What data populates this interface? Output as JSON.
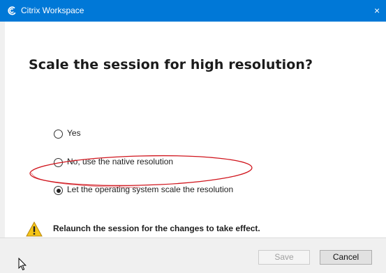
{
  "window": {
    "title": "Citrix Workspace",
    "close_glyph": "×",
    "accent_color": "#0078d7"
  },
  "dialog": {
    "heading": "Scale the session for high resolution?",
    "options": [
      {
        "label": "Yes",
        "selected": false
      },
      {
        "label": "No, use the native resolution",
        "selected": false
      },
      {
        "label": "Let the operating system scale the resolution",
        "selected": true
      }
    ],
    "warning_text": "Relaunch the session for the changes to take effect.",
    "warning_icon": "warning-triangle-icon",
    "highlight_color": "#d0141c"
  },
  "footer": {
    "save_label": "Save",
    "save_enabled": false,
    "cancel_label": "Cancel"
  }
}
